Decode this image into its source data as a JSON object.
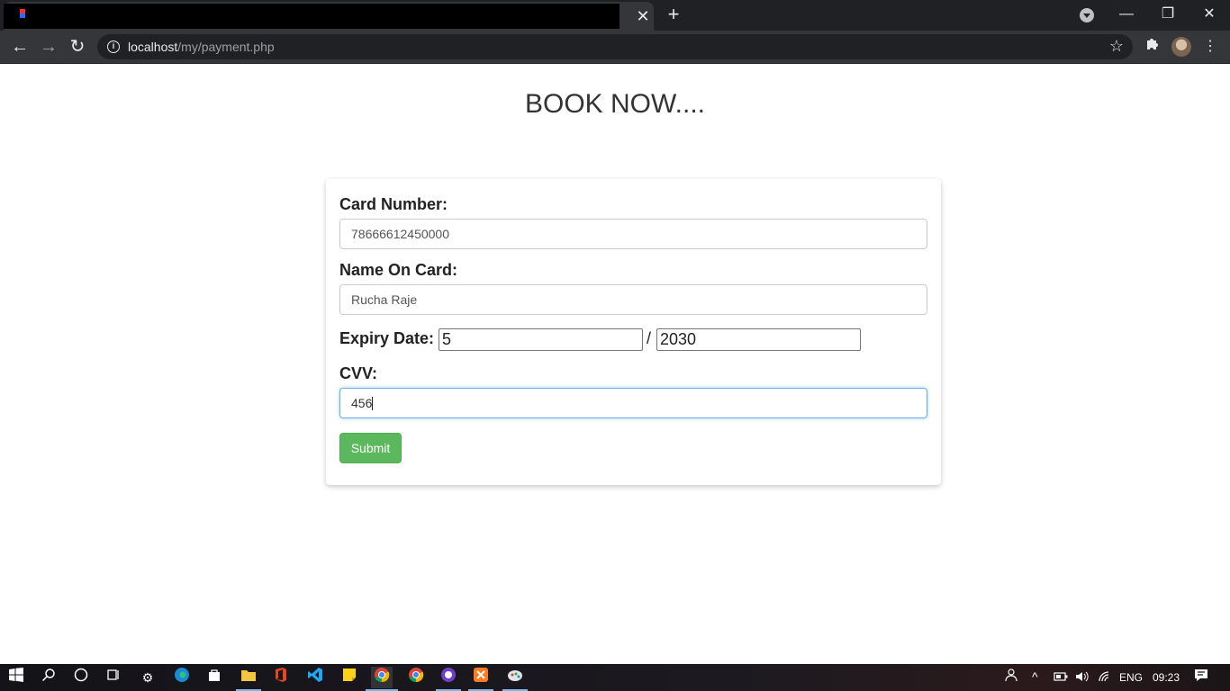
{
  "browser": {
    "tab_close": "✕",
    "new_tab": "+",
    "window_controls": {
      "minimize": "—",
      "restore": "❐",
      "close": "✕"
    },
    "nav": {
      "back": "←",
      "forward": "→",
      "reload": "↻"
    },
    "url_host": "localhost",
    "url_path": "/my/payment.php",
    "bookmark_star": "☆",
    "extensions_icon": "puzzle-icon"
  },
  "page": {
    "heading": "BOOK NOW....",
    "form": {
      "card_number_label": "Card Number:",
      "card_number_value": "78666612450000",
      "name_label": "Name On Card:",
      "name_value": "Rucha Raje",
      "expiry_label": "Expiry Date:",
      "expiry_month": "5",
      "expiry_separator": "/",
      "expiry_year": "2030",
      "cvv_label": "CVV:",
      "cvv_value": "456",
      "submit_label": "Submit"
    },
    "colors": {
      "submit_bg": "#5cb85c",
      "focus_border": "#66afe9"
    }
  },
  "taskbar": {
    "language": "ENG",
    "time": "09:23"
  }
}
